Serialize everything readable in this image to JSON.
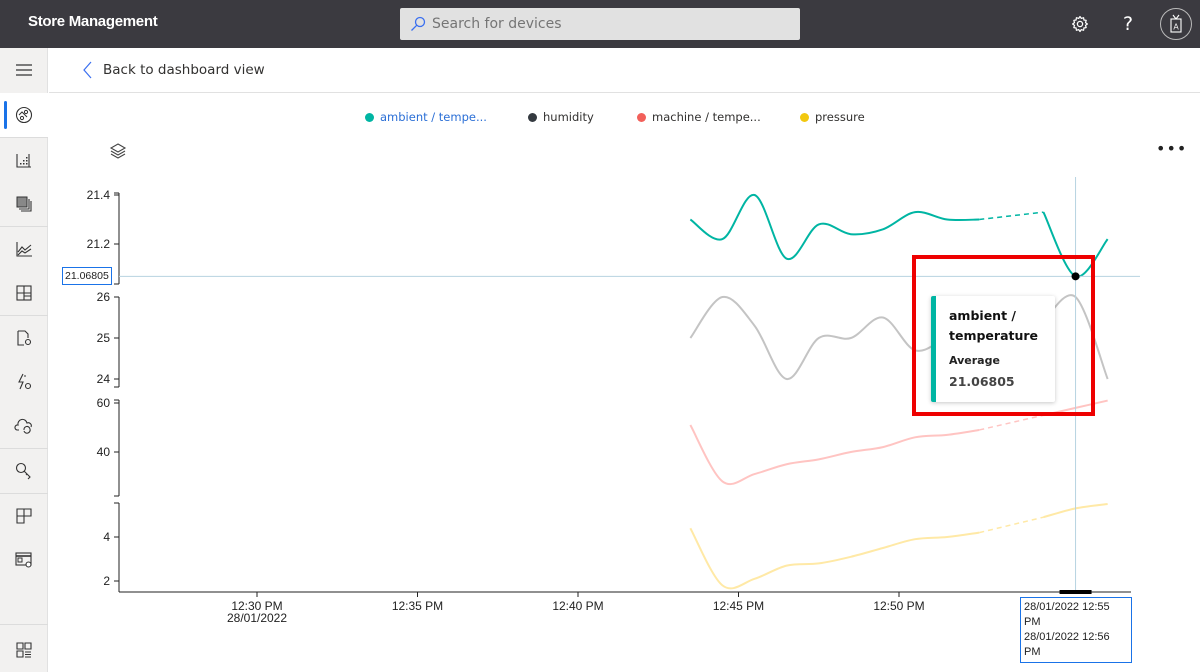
{
  "header": {
    "app_title": "Store Management",
    "search_placeholder": "Search for devices",
    "icons": [
      "settings-icon",
      "help-icon",
      "account-icon"
    ],
    "help_glyph": "?"
  },
  "sidebar": {
    "items": [
      {
        "name": "hamburger-menu",
        "icon": "menu-icon",
        "active": false
      },
      {
        "name": "dashboard",
        "icon": "dashboard-icon",
        "active": true
      },
      {
        "name": "devices",
        "icon": "devices-icon",
        "active": false
      },
      {
        "name": "device-groups",
        "icon": "device-groups-icon",
        "active": false
      },
      {
        "name": "analytics",
        "icon": "analytics-icon",
        "active": false
      },
      {
        "name": "rules",
        "icon": "rules-icon",
        "active": false
      },
      {
        "name": "jobs",
        "icon": "jobs-icon",
        "active": false
      },
      {
        "name": "device-templates",
        "icon": "device-templates-icon",
        "active": false
      },
      {
        "name": "data-export",
        "icon": "data-export-icon",
        "active": false
      },
      {
        "name": "permissions",
        "icon": "key-icon",
        "active": false
      },
      {
        "name": "customization",
        "icon": "customization-icon",
        "active": false
      },
      {
        "name": "administration",
        "icon": "admin-icon",
        "active": false
      },
      {
        "name": "app-gallery",
        "icon": "app-gallery-icon",
        "active": false
      }
    ]
  },
  "subheader": {
    "back_label": "Back to dashboard view"
  },
  "chart_toolbar": {
    "layers_icon": "layers-icon",
    "more_label": "•••"
  },
  "tooltip": {
    "title_line1": "ambient /",
    "title_line2": "temperature",
    "label": "Average",
    "value": "21.06805"
  },
  "cursor": {
    "y_readout": "21.06805",
    "x_readout_line1": "28/01/2022 12:55 PM",
    "x_readout_line2": "28/01/2022 12:56 PM"
  },
  "chart_data": {
    "type": "line",
    "title": "",
    "xlabel": "",
    "ylabel": "",
    "x_tick_labels": [
      "12:30 PM",
      "12:35 PM",
      "12:40 PM",
      "12:45 PM",
      "12:50 PM"
    ],
    "x_tick_minutes": [
      30,
      35,
      40,
      45,
      50
    ],
    "x_date_label": "28/01/2022",
    "x_range_minutes": [
      25.8,
      56.8
    ],
    "x": [
      43.5,
      44.5,
      45.5,
      46.5,
      47.5,
      48.5,
      49.5,
      50.5,
      51.5,
      52.5,
      54.5,
      55.5,
      56.5
    ],
    "gap_after_index": 9,
    "legend_position": "top-center",
    "grid": false,
    "series": [
      {
        "name": "ambient / tempe...",
        "full_name": "ambient / temperature",
        "color": "#00b5a3",
        "legend_text_color": "#2b6fd6",
        "ylim": [
          21.06,
          21.42
        ],
        "yticks": [
          21.2,
          21.4
        ],
        "values": [
          21.3,
          21.22,
          21.4,
          21.14,
          21.28,
          21.24,
          21.26,
          21.33,
          21.3,
          21.3,
          21.33,
          21.068,
          21.22
        ]
      },
      {
        "name": "humidity",
        "full_name": "humidity",
        "color": "#c4c4c4",
        "legend_dot_color": "#343a40",
        "legend_text_color": "#323130",
        "ylim": [
          23.95,
          26.0
        ],
        "yticks": [
          24,
          25,
          26
        ],
        "values": [
          25.0,
          26.0,
          25.3,
          24.0,
          25.0,
          25.0,
          25.5,
          24.7,
          25.0,
          25.2,
          25.4,
          26.0,
          24.0
        ]
      },
      {
        "name": "machine / tempe...",
        "full_name": "machine / temperature",
        "color": "#ffc4c2",
        "legend_dot_color": "#f2605a",
        "legend_text_color": "#323130",
        "ylim": [
          25,
          61
        ],
        "yticks": [
          40,
          60
        ],
        "values": [
          51,
          28,
          31,
          35,
          37,
          40,
          42,
          46,
          47,
          49,
          55,
          58,
          61
        ]
      },
      {
        "name": "pressure",
        "full_name": "pressure",
        "color": "#ffe9a6",
        "legend_dot_color": "#f2c80f",
        "legend_text_color": "#323130",
        "ylim": [
          1.5,
          5.6
        ],
        "yticks": [
          2,
          4
        ],
        "values": [
          4.4,
          1.8,
          2.1,
          2.7,
          2.8,
          3.1,
          3.5,
          3.9,
          4.0,
          4.2,
          4.9,
          5.3,
          5.5
        ]
      }
    ],
    "hover": {
      "series": "ambient / temperature",
      "x_minutes": 55.5,
      "value": 21.06805
    }
  }
}
